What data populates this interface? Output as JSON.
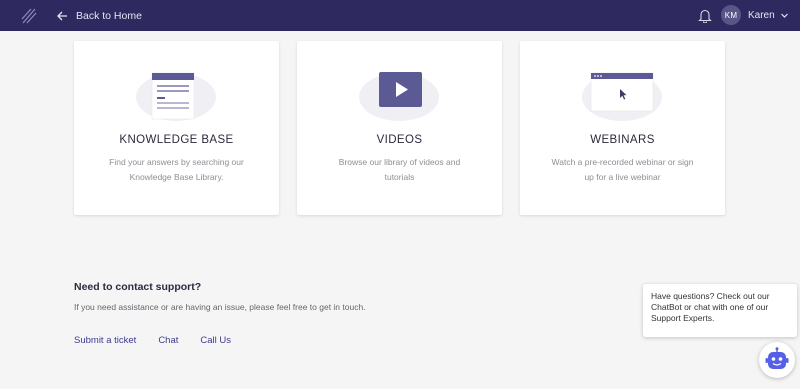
{
  "header": {
    "back_label": "Back to Home",
    "user_initials": "KM",
    "user_name": "Karen"
  },
  "cards": [
    {
      "title": "KNOWLEDGE BASE",
      "description": "Find your answers by searching our Knowledge Base Library.",
      "icon": "document-icon"
    },
    {
      "title": "VIDEOS",
      "description": "Browse our library of videos and tutorials",
      "icon": "play-icon"
    },
    {
      "title": "WEBINARS",
      "description": "Watch a pre-recorded webinar or sign up for a live webinar",
      "icon": "browser-window-icon"
    }
  ],
  "support": {
    "heading": "Need to contact support?",
    "text": "If you need assistance or are having an issue, please feel free to get in touch.",
    "links": [
      "Submit a ticket",
      "Chat",
      "Call Us"
    ]
  },
  "chatbot": {
    "bubble_text": "Have questions? Check out our ChatBot or chat with one of our Support Experts.",
    "icon": "robot-icon"
  },
  "colors": {
    "header_bg": "#2e2a5f",
    "accent": "#5c5a94",
    "link": "#3d3b8e",
    "bot": "#5560e6"
  }
}
